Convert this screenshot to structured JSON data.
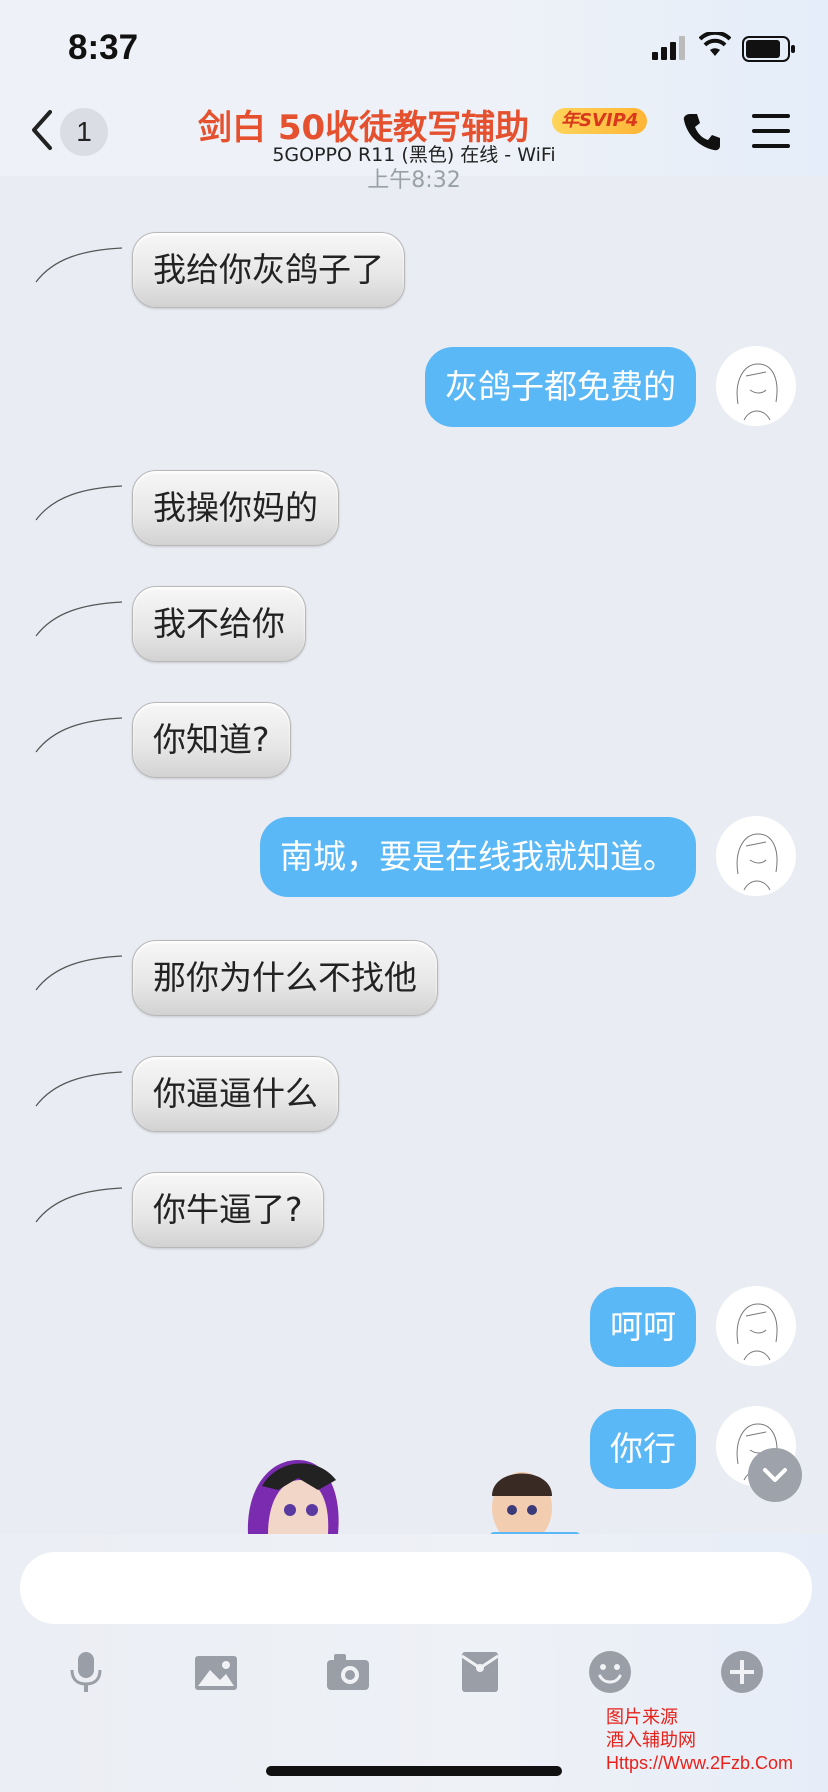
{
  "status_bar": {
    "time": "8:37"
  },
  "header": {
    "back_count": "1",
    "title": "剑白  50收徒教写辅助",
    "badge": "年SVIP4",
    "subtitle": "5GOPPO R11 (黑色) 在线 - WiFi",
    "timestamp": "上午8:32"
  },
  "messages": [
    {
      "side": "left",
      "text": "我给你灰鸽子了"
    },
    {
      "side": "right",
      "text": "灰鸽子都免费的"
    },
    {
      "side": "left",
      "text": "我操你妈的"
    },
    {
      "side": "left",
      "text": "我不给你"
    },
    {
      "side": "left",
      "text": "你知道?"
    },
    {
      "side": "right",
      "text": "南城，要是在线我就知道。"
    },
    {
      "side": "left",
      "text": "那你为什么不找他"
    },
    {
      "side": "left",
      "text": "你逼逼什么"
    },
    {
      "side": "left",
      "text": "你牛逼了?"
    },
    {
      "side": "right",
      "text": "呵呵"
    },
    {
      "side": "right",
      "text": "你行"
    }
  ],
  "input": {
    "placeholder": ""
  },
  "toolbar": [
    "mic-icon",
    "image-icon",
    "camera-icon",
    "red-packet-icon",
    "emoji-icon",
    "plus-icon"
  ],
  "watermark": {
    "line1": "图片来源",
    "line2": "酒入辅助网",
    "line3": "Https://Www.2Fzb.Com"
  },
  "colors": {
    "accent_blue": "#5bb8f6",
    "title_red": "#e5502e"
  }
}
